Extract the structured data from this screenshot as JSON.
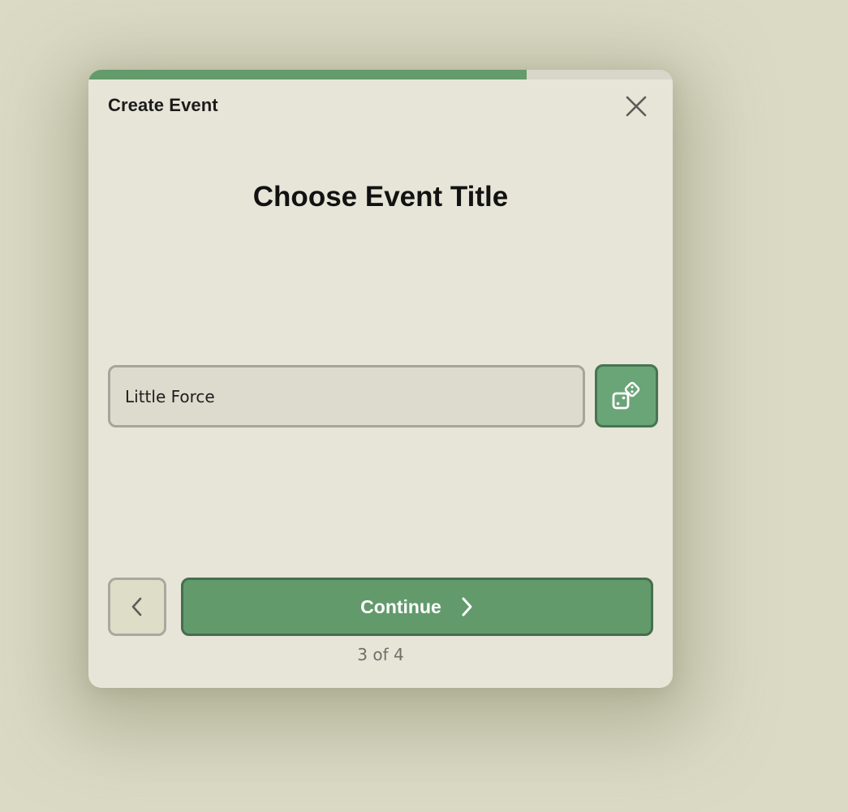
{
  "modal": {
    "title": "Create Event",
    "progress": 0.75,
    "colors": {
      "accent": "#639a6c",
      "surface": "#e7e5d8",
      "backdrop": "#dbdac5"
    }
  },
  "step": {
    "heading": "Choose Event Title",
    "counter": "3 of 4"
  },
  "title_input": {
    "value": "Little Force",
    "placeholder": ""
  },
  "icons": {
    "close": "close-icon",
    "randomize": "dice-icon",
    "back": "chevron-left-icon",
    "continue": "chevron-right-icon"
  },
  "buttons": {
    "continue_label": "Continue"
  }
}
